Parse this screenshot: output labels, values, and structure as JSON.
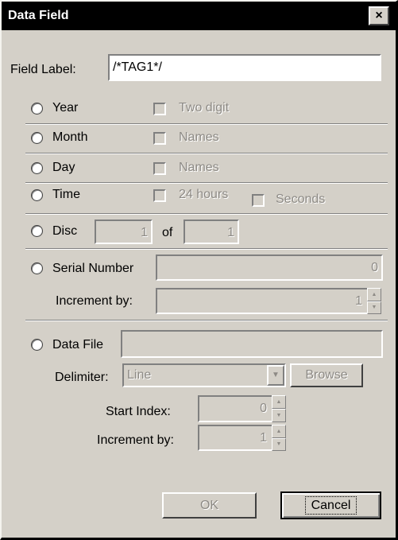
{
  "window": {
    "title": "Data Field",
    "close_glyph": "×",
    "close_icon": "close-icon"
  },
  "field_label": {
    "label": "Field Label:",
    "value": "/*TAG1*/"
  },
  "options": {
    "year": {
      "label": "Year",
      "check": "Two digit"
    },
    "month": {
      "label": "Month",
      "check": "Names"
    },
    "day": {
      "label": "Day",
      "check": "Names"
    },
    "time": {
      "label": "Time",
      "check1": "24 hours",
      "check2": "Seconds"
    },
    "disc": {
      "label": "Disc",
      "value1": "1",
      "of_label": "of",
      "value2": "1"
    },
    "serial": {
      "label": "Serial Number",
      "value": "0",
      "increment_label": "Increment by:",
      "increment_value": "1"
    },
    "datafile": {
      "label": "Data File",
      "value": "",
      "delimiter_label": "Delimiter:",
      "delimiter_value": "Line",
      "browse_label": "Browse",
      "start_index_label": "Start Index:",
      "start_index_value": "0",
      "increment_label": "Increment by:",
      "increment_value": "1"
    }
  },
  "buttons": {
    "ok": "OK",
    "cancel": "Cancel"
  }
}
